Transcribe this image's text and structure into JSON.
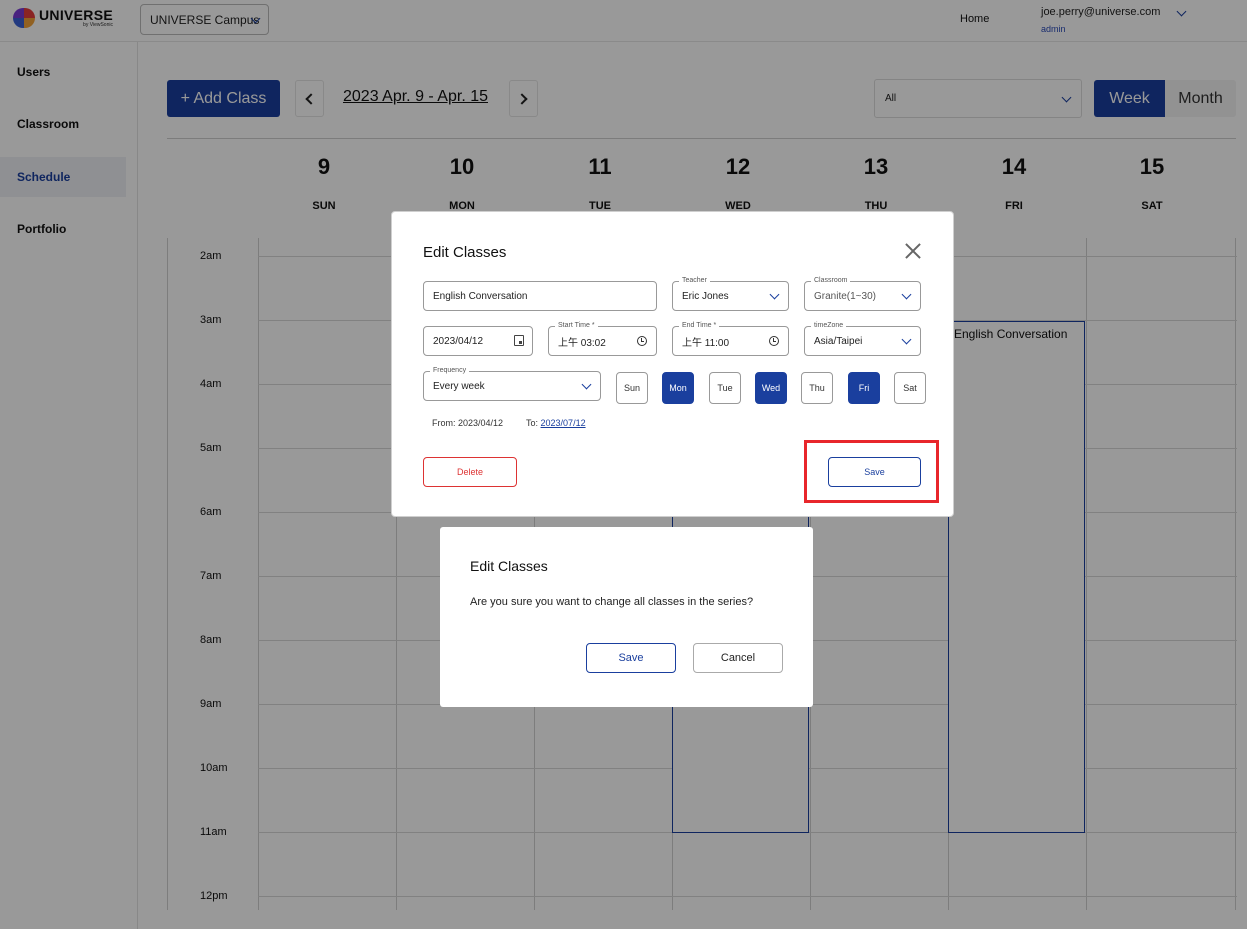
{
  "brand": {
    "name": "UNIVERSE",
    "sub": "by ViewSonic"
  },
  "topbar": {
    "campus": "UNIVERSE Campus",
    "home": "Home",
    "email": "joe.perry@universe.com",
    "role": "admin"
  },
  "sidebar": {
    "items": [
      {
        "label": "Users"
      },
      {
        "label": "Classroom"
      },
      {
        "label": "Schedule"
      },
      {
        "label": "Portfolio"
      }
    ],
    "active": "Schedule"
  },
  "toolbar": {
    "add_label": "+ Add Class",
    "range": "2023 Apr. 9 - Apr. 15",
    "filter_value": "All",
    "week_label": "Week",
    "month_label": "Month",
    "active_view": "Week"
  },
  "days": [
    {
      "num": "9",
      "name": "SUN"
    },
    {
      "num": "10",
      "name": "MON"
    },
    {
      "num": "11",
      "name": "TUE"
    },
    {
      "num": "12",
      "name": "WED"
    },
    {
      "num": "13",
      "name": "THU"
    },
    {
      "num": "14",
      "name": "FRI"
    },
    {
      "num": "15",
      "name": "SAT"
    }
  ],
  "times": [
    "2am",
    "3am",
    "4am",
    "5am",
    "6am",
    "7am",
    "8am",
    "9am",
    "10am",
    "11am",
    "12pm"
  ],
  "events": [
    {
      "title": "English Conversation",
      "day": "FRI"
    },
    {
      "title": "",
      "day": "WED"
    }
  ],
  "edit_modal": {
    "title": "Edit Classes",
    "class_name": "English Conversation",
    "teacher_label": "Teacher",
    "teacher": "Eric Jones",
    "classroom_label": "Classroom",
    "classroom": "Granite(1~30)",
    "date": "2023/04/12",
    "start_label": "Start Time *",
    "start": "上午 03:02",
    "end_label": "End Time *",
    "end": "上午 11:00",
    "tz_label": "timeZone",
    "tz": "Asia/Taipei",
    "freq_label": "Frequency",
    "freq": "Every week",
    "weekdays": [
      {
        "label": "Sun",
        "on": false
      },
      {
        "label": "Mon",
        "on": true
      },
      {
        "label": "Tue",
        "on": false
      },
      {
        "label": "Wed",
        "on": true
      },
      {
        "label": "Thu",
        "on": false
      },
      {
        "label": "Fri",
        "on": true
      },
      {
        "label": "Sat",
        "on": false
      }
    ],
    "from_text": "From: 2023/04/12",
    "to_prefix": "To:",
    "to_date": "2023/07/12",
    "delete_label": "Delete",
    "save_label": "Save"
  },
  "confirm": {
    "title": "Edit Classes",
    "message": "Are you sure you want to change all classes in the series?",
    "save_label": "Save",
    "cancel_label": "Cancel"
  },
  "colors": {
    "primary": "#1a3f9e",
    "danger": "#dd3333",
    "highlight": "#e8262b"
  }
}
